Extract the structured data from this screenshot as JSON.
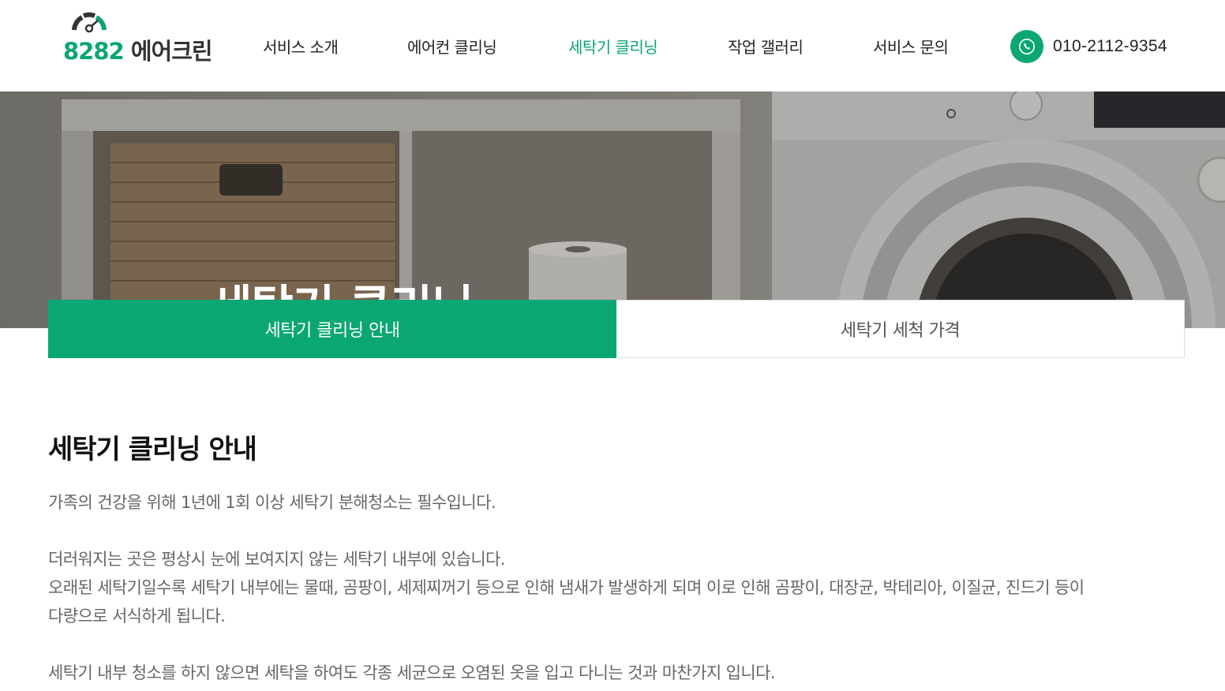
{
  "header": {
    "logo": {
      "number": "8282",
      "name": "에어크린"
    },
    "nav": [
      {
        "label": "서비스 소개",
        "active": false
      },
      {
        "label": "에어컨 클리닝",
        "active": false
      },
      {
        "label": "세탁기 클리닝",
        "active": true
      },
      {
        "label": "작업 갤러리",
        "active": false
      },
      {
        "label": "서비스 문의",
        "active": false
      }
    ],
    "phone": {
      "icon": "phone-icon",
      "number": "010-2112-9354"
    }
  },
  "banner": {
    "title": "세탁기 클리닝"
  },
  "tabs": [
    {
      "label": "세탁기 클리닝 안내",
      "active": true
    },
    {
      "label": "세탁기 세척 가격",
      "active": false
    }
  ],
  "content": {
    "title": "세탁기 클리닝 안내",
    "paragraphs": [
      "가족의 건강을 위해 1년에 1회 이상 세탁기 분해청소는 필수입니다.",
      "더러워지는 곳은 평상시 눈에 보여지지 않는 세탁기 내부에 있습니다.",
      "오래된 세탁기일수록 세탁기 내부에는 물때, 곰팡이, 세제찌꺼기 등으로 인해 냄새가 발생하게 되며 이로 인해 곰팡이, 대장균, 박테리아, 이질균, 진드기 등이",
      "다량으로 서식하게 됩니다.",
      "세탁기 내부 청소를 하지 않으면 세탁을 하여도 각종 세균으로 오염된 옷을 입고 다니는 것과 마찬가지 입니다."
    ]
  },
  "colors": {
    "accent": "#0aa674",
    "text_muted": "#666666"
  }
}
